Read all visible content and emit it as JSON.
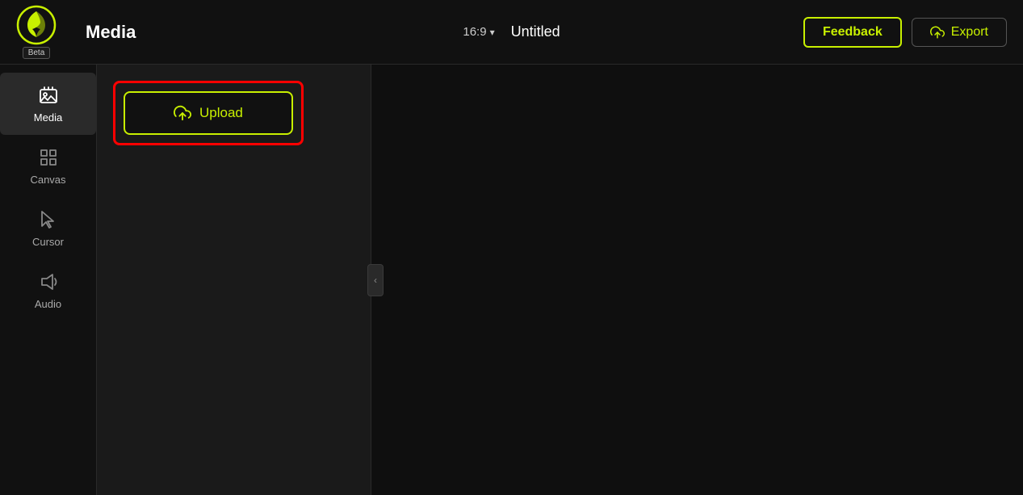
{
  "header": {
    "logo_alt": "Pika Logo",
    "beta_label": "Beta",
    "media_title": "Media",
    "aspect_ratio": "16:9",
    "doc_title": "Untitled",
    "feedback_label": "Feedback",
    "export_label": "Export"
  },
  "sidebar": {
    "items": [
      {
        "id": "media",
        "label": "Media",
        "active": true
      },
      {
        "id": "canvas",
        "label": "Canvas",
        "active": false
      },
      {
        "id": "cursor",
        "label": "Cursor",
        "active": false
      },
      {
        "id": "audio",
        "label": "Audio",
        "active": false
      }
    ]
  },
  "panel": {
    "upload_label": "Upload"
  },
  "collapse_icon": "‹"
}
